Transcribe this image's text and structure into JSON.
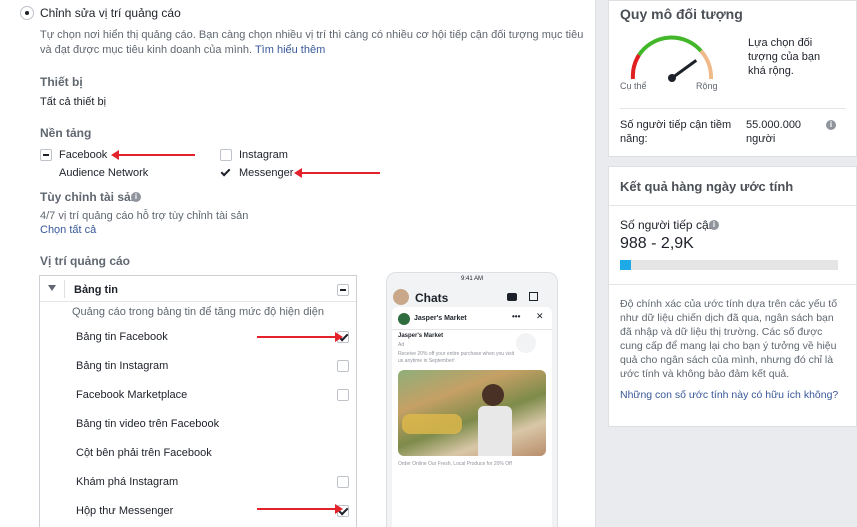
{
  "placement": {
    "radio_label": "Chỉnh sửa vị trí quảng cáo",
    "description_line1": "Tự chọn nơi hiển thị quảng cáo. Bạn càng chọn nhiều vị trí thì càng có nhiều cơ hội tiếp cận đối tượng mục tiêu",
    "description_line2": "và đạt được mục tiêu kinh doanh của mình.",
    "learn_more": "Tìm hiểu thêm"
  },
  "devices": {
    "title": "Thiết bị",
    "value": "Tất cả thiết bị"
  },
  "platforms": {
    "title": "Nền tảng",
    "items": [
      {
        "label": "Facebook",
        "state": "partial"
      },
      {
        "label": "Instagram",
        "state": "unchecked"
      },
      {
        "label": "Audience Network",
        "state": "unchecked"
      },
      {
        "label": "Messenger",
        "state": "checked"
      }
    ]
  },
  "asset_customization": {
    "title": "Tùy chỉnh tài sản",
    "info": "i",
    "note": "4/7 vị trí quảng cáo hỗ trợ tùy chỉnh tài sản",
    "select_all": "Chọn tất cả"
  },
  "positions": {
    "title": "Vị trí quảng cáo",
    "group": {
      "label": "Bảng tin",
      "description": "Quảng cáo trong bảng tin để tăng mức độ hiện diện",
      "items": [
        {
          "label": "Bảng tin Facebook",
          "checked": true,
          "has_checkbox": true
        },
        {
          "label": "Bảng tin Instagram",
          "checked": false,
          "has_checkbox": true
        },
        {
          "label": "Facebook Marketplace",
          "checked": false,
          "has_checkbox": true
        },
        {
          "label": "Bảng tin video trên Facebook",
          "checked": false,
          "has_checkbox": false
        },
        {
          "label": "Cột bên phải trên Facebook",
          "checked": false,
          "has_checkbox": false
        },
        {
          "label": "Khám phá Instagram",
          "checked": false,
          "has_checkbox": true
        },
        {
          "label": "Hộp thư Messenger",
          "checked": true,
          "has_checkbox": true
        }
      ]
    }
  },
  "preview": {
    "status_time": "9:41 AM",
    "chats_title": "Chats",
    "page_name": "Jasper's Market",
    "card_title": "Jasper's Market",
    "ad_label": "Ad",
    "ad_text": "Receive 20% off your entire purchase when you visit us anytime in September!",
    "footer": "Order Online Our Fresh, Local Produce for 20% Off"
  },
  "audience": {
    "title": "Quy mô đối tượng",
    "gauge_note": "Lựa chọn đối tượng của bạn khá rộng.",
    "label_specific": "Cụ thể",
    "label_broad": "Rộng",
    "potential_label": "Số người tiếp cận tiềm năng:",
    "potential_value": "55.000.000 người",
    "info": "i",
    "gauge_level": 0.8
  },
  "estimate": {
    "title": "Kết quả hàng ngày ước tính",
    "reach_label": "Số người tiếp cận",
    "info": "i",
    "reach_value": "988 - 2,9K",
    "reach_fill": 0.05,
    "disclaimer": "Độ chính xác của ước tính dựa trên các yếu tố như dữ liệu chiến dịch đã qua, ngân sách bạn đã nhập và dữ liệu thị trường. Các số được cung cấp để mang lại cho bạn ý tưởng về hiệu quả cho ngân sách của mình, nhưng đó chỉ là ước tính và không bảo đảm kết quả.",
    "helpful_question": "Những con số ước tính này có hữu ích không?"
  },
  "colors": {
    "accent": "#385898",
    "arrow": "#e3222b",
    "bar_fill": "#1eaae7",
    "gauge_green": "#42b72a"
  }
}
